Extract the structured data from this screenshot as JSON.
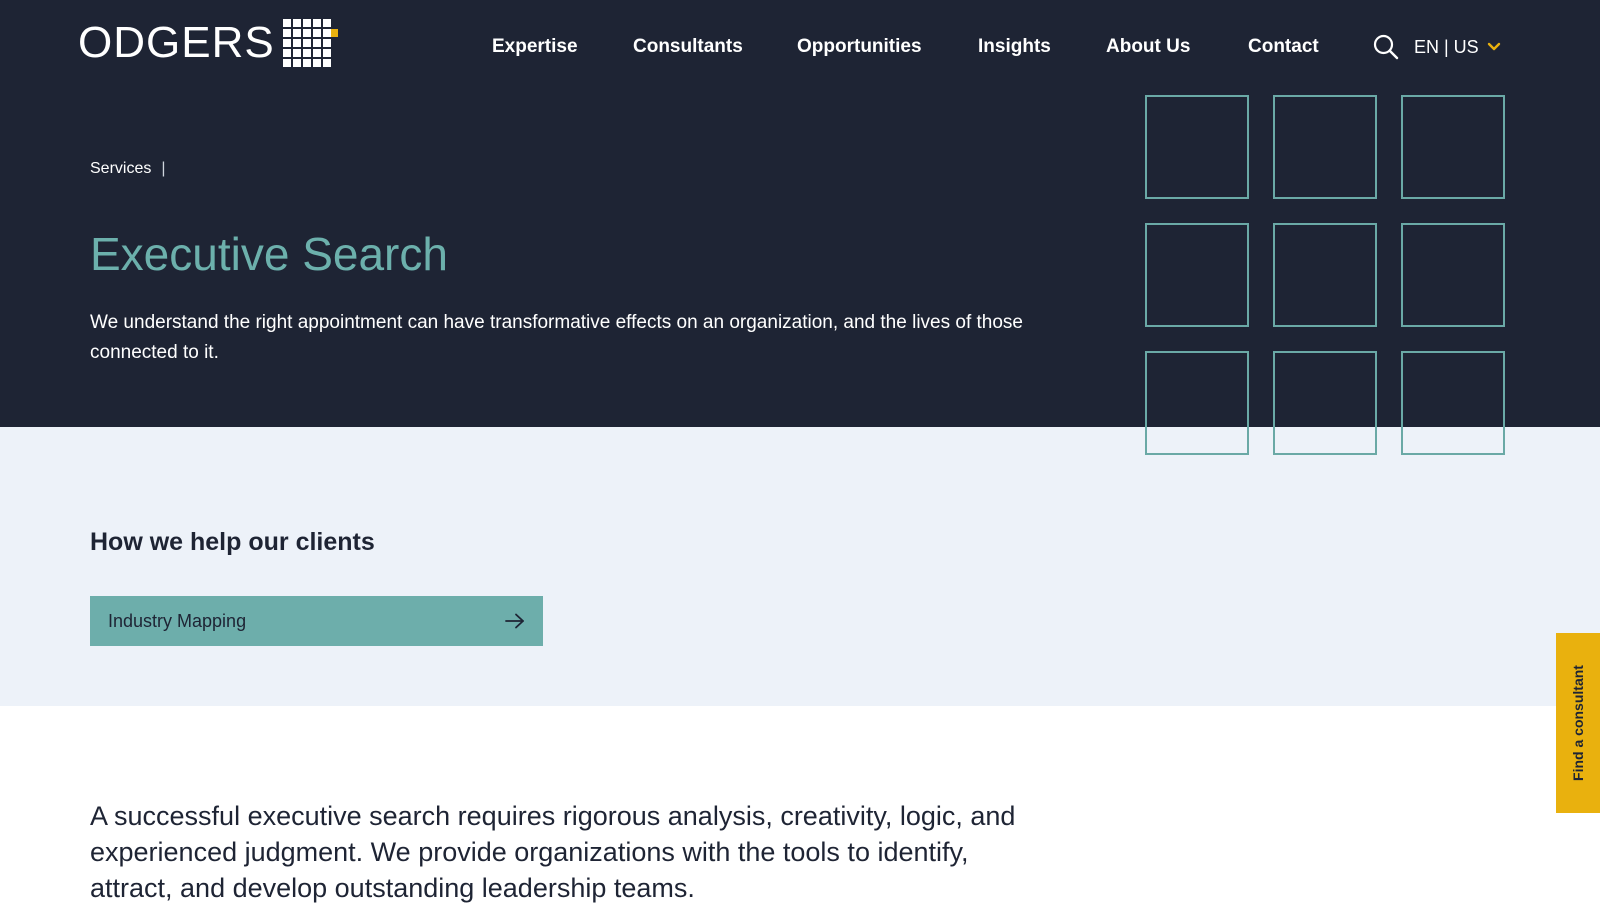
{
  "header": {
    "logo_text": "ODGERS",
    "nav": [
      {
        "label": "Expertise"
      },
      {
        "label": "Consultants"
      },
      {
        "label": "Opportunities"
      },
      {
        "label": "Insights"
      },
      {
        "label": "About Us"
      },
      {
        "label": "Contact"
      }
    ],
    "search_icon": "search-icon",
    "language": "EN | US"
  },
  "hero": {
    "breadcrumb": "Services",
    "breadcrumb_separator": "|",
    "title": "Executive Search",
    "description": "We understand the right appointment can have transformative effects on an organization, and the lives of those connected to it."
  },
  "help": {
    "title": "How we help our clients",
    "button_label": "Industry Mapping"
  },
  "intro": {
    "text": "A successful executive search requires rigorous analysis, creativity, logic, and experienced judgment. We provide organizations with the tools to identify, attract, and develop outstanding leadership teams."
  },
  "side_tab": {
    "label": "Find a consultant"
  },
  "colors": {
    "hero_bg": "#1e2434",
    "accent_teal": "#6cb0ac",
    "accent_yellow": "#e9b10e",
    "light_bg": "#edf2f9"
  }
}
